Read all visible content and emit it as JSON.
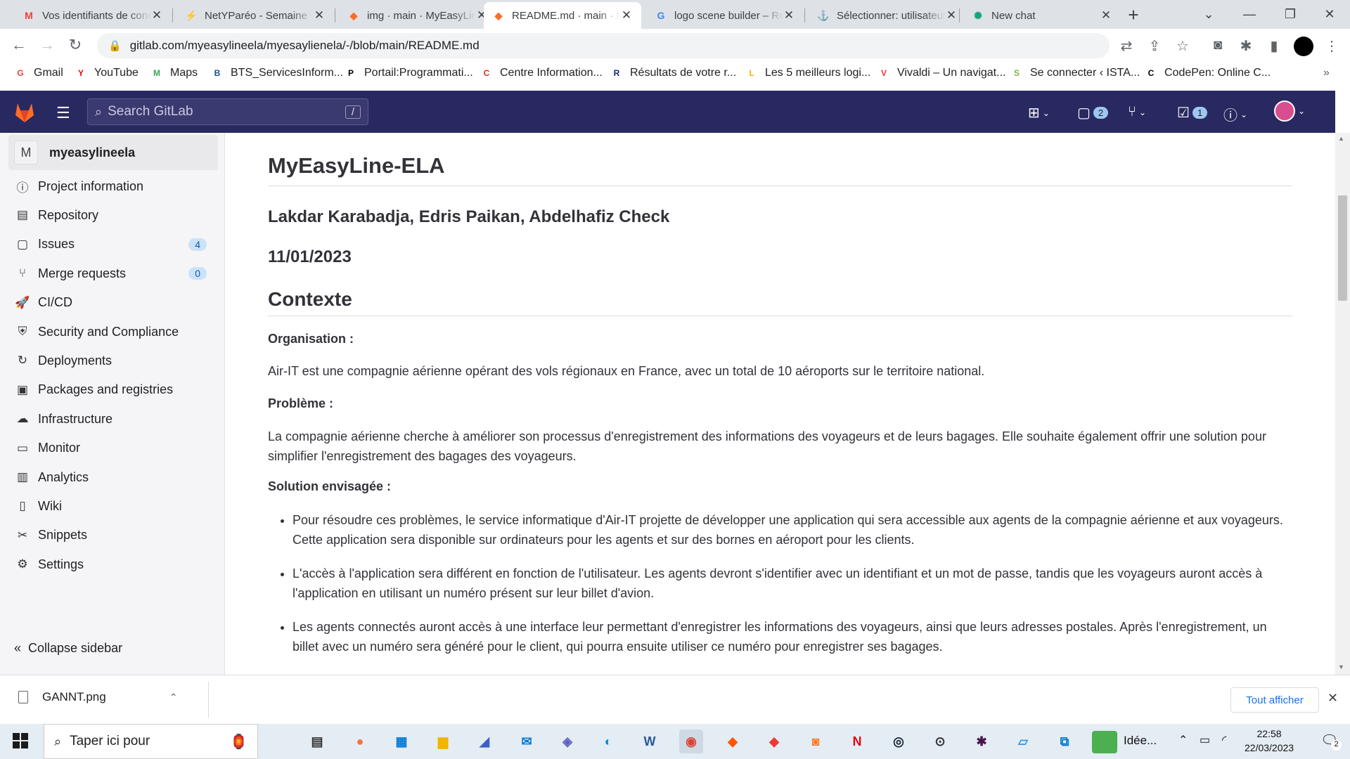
{
  "browser": {
    "tabs": [
      {
        "title": "Vos identifiants de connexion",
        "favicon": "gmail-icon",
        "active": false
      },
      {
        "title": "NetYParéo - Semaine",
        "favicon": "netypareo-icon",
        "active": false
      },
      {
        "title": "img · main · MyEasyLine",
        "favicon": "gitlab-icon",
        "active": false
      },
      {
        "title": "README.md · main · MyEasyLine",
        "favicon": "gitlab-icon",
        "active": true
      },
      {
        "title": "logo scene builder – Recherche",
        "favicon": "google-icon",
        "active": false
      },
      {
        "title": "Sélectionner: utilisateurs",
        "favicon": "phpmyadmin-icon",
        "active": false
      },
      {
        "title": "New chat",
        "favicon": "chatgpt-icon",
        "active": false
      }
    ],
    "url": "gitlab.com/myeasylineela/myesaylienela/-/blob/main/README.md",
    "bookmarks": [
      {
        "label": "Gmail",
        "icon": "gmail-icon",
        "color": "#ea4335"
      },
      {
        "label": "YouTube",
        "icon": "youtube-icon",
        "color": "#ff0000"
      },
      {
        "label": "Maps",
        "icon": "maps-icon",
        "color": "#34a853"
      },
      {
        "label": "BTS_ServicesInform...",
        "icon": "bts-icon",
        "color": "#1a4e8a"
      },
      {
        "label": "Portail:Programmati...",
        "icon": "wikipedia-icon",
        "color": "#000000"
      },
      {
        "label": "Centre Information...",
        "icon": "cil-icon",
        "color": "#d93025"
      },
      {
        "label": "Résultats de votre r...",
        "icon": "result-icon",
        "color": "#1a237e"
      },
      {
        "label": "Les 5 meilleurs logi...",
        "icon": "software-icon",
        "color": "#f4b400"
      },
      {
        "label": "Vivaldi – Un navigat...",
        "icon": "vivaldi-icon",
        "color": "#ef3939"
      },
      {
        "label": "Se connecter ‹ ISTA...",
        "icon": "ista-icon",
        "color": "#7cb342"
      },
      {
        "label": "CodePen: Online C...",
        "icon": "codepen-icon",
        "color": "#000000"
      }
    ]
  },
  "gitlab": {
    "search_placeholder": "Search GitLab",
    "search_shortcut": "/",
    "issues_badge": "2",
    "todo_badge": "1",
    "project_avatar": "M",
    "project_name": "myeasylineela",
    "nav": [
      {
        "label": "Project information",
        "icon": "info-icon",
        "badge": ""
      },
      {
        "label": "Repository",
        "icon": "repository-icon",
        "badge": ""
      },
      {
        "label": "Issues",
        "icon": "issues-icon",
        "badge": "4"
      },
      {
        "label": "Merge requests",
        "icon": "merge-request-icon",
        "badge": "0"
      },
      {
        "label": "CI/CD",
        "icon": "rocket-icon",
        "badge": ""
      },
      {
        "label": "Security and Compliance",
        "icon": "shield-icon",
        "badge": ""
      },
      {
        "label": "Deployments",
        "icon": "deployments-icon",
        "badge": ""
      },
      {
        "label": "Packages and registries",
        "icon": "package-icon",
        "badge": ""
      },
      {
        "label": "Infrastructure",
        "icon": "cloud-icon",
        "badge": ""
      },
      {
        "label": "Monitor",
        "icon": "monitor-icon",
        "badge": ""
      },
      {
        "label": "Analytics",
        "icon": "chart-icon",
        "badge": ""
      },
      {
        "label": "Wiki",
        "icon": "book-icon",
        "badge": ""
      },
      {
        "label": "Snippets",
        "icon": "snippet-icon",
        "badge": ""
      },
      {
        "label": "Settings",
        "icon": "gear-icon",
        "badge": ""
      }
    ],
    "collapse_label": "Collapse sidebar"
  },
  "readme": {
    "title": "MyEasyLine-ELA",
    "authors": "Lakdar Karabadja, Edris Paikan, Abdelhafiz Check",
    "date": "11/01/2023",
    "section": "Contexte",
    "org_label": "Organisation :",
    "org_text": "Air-IT est une compagnie aérienne opérant des vols régionaux en France, avec un total de 10 aéroports sur le territoire national.",
    "problem_label": "Problème :",
    "problem_text": "La compagnie aérienne cherche à améliorer son processus d'enregistrement des informations des voyageurs et de leurs bagages. Elle souhaite également offrir une solution pour simplifier l'enregistrement des bagages des voyageurs.",
    "solution_label": "Solution envisagée :",
    "solution_items": [
      "Pour résoudre ces problèmes, le service informatique d'Air-IT projette de développer une application qui sera accessible aux agents de la compagnie aérienne et aux voyageurs. Cette application sera disponible sur ordinateurs pour les agents et sur des bornes en aéroport pour les clients.",
      "L'accès à l'application sera différent en fonction de l'utilisateur. Les agents devront s'identifier avec un identifiant et un mot de passe, tandis que les voyageurs auront accès à l'application en utilisant un numéro présent sur leur billet d'avion.",
      "Les agents connectés auront accès à une interface leur permettant d'enregistrer les informations des voyageurs, ainsi que leurs adresses postales. Après l'enregistrement, un billet avec un numéro sera généré pour le client, qui pourra ensuite utiliser ce numéro pour enregistrer ses bagages."
    ]
  },
  "downloads": {
    "file": "GANNT.png",
    "show_all": "Tout afficher"
  },
  "taskbar": {
    "search_placeholder": "Taper ici pour",
    "app_label": "Idée...",
    "time": "22:58",
    "date": "22/03/2023",
    "notifications": "2"
  }
}
